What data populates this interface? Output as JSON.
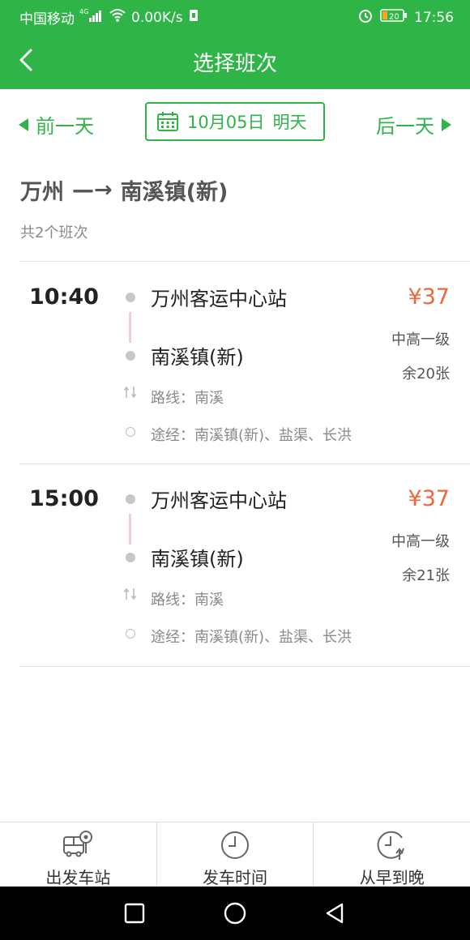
{
  "status_bar": {
    "carrier": "中国移动",
    "network_badge": "4G",
    "speed": "0.00K/s",
    "battery": "20",
    "time": "17:56"
  },
  "header": {
    "title": "选择班次",
    "back_icon": "chevron-left-icon"
  },
  "date_bar": {
    "prev_label": "前一天",
    "next_label": "后一天",
    "date": "10月05日",
    "day": "明天",
    "accent": "#2fb547"
  },
  "route": {
    "from": "万州",
    "arrow": "—→",
    "to": "南溪镇(新)",
    "count_text": "共2个班次"
  },
  "trips": [
    {
      "time": "10:40",
      "from_station": "万州客运中心站",
      "to_station": "南溪镇(新)",
      "price": "¥37",
      "bus_type": "中高一级",
      "seats": "余20张",
      "route_line": "路线：南溪",
      "via": "途经：南溪镇(新)、盐渠、长洪"
    },
    {
      "time": "15:00",
      "from_station": "万州客运中心站",
      "to_station": "南溪镇(新)",
      "price": "¥37",
      "bus_type": "中高一级",
      "seats": "余21张",
      "route_line": "路线：南溪",
      "via": "途经：南溪镇(新)、盐渠、长洪"
    }
  ],
  "tabs": [
    {
      "label": "出发车站",
      "icon": "bus-station-icon"
    },
    {
      "label": "发车时间",
      "icon": "clock-icon"
    },
    {
      "label": "从早到晚",
      "icon": "clock-up-icon"
    }
  ],
  "colors": {
    "primary": "#2fb547",
    "price": "#f0653a"
  }
}
